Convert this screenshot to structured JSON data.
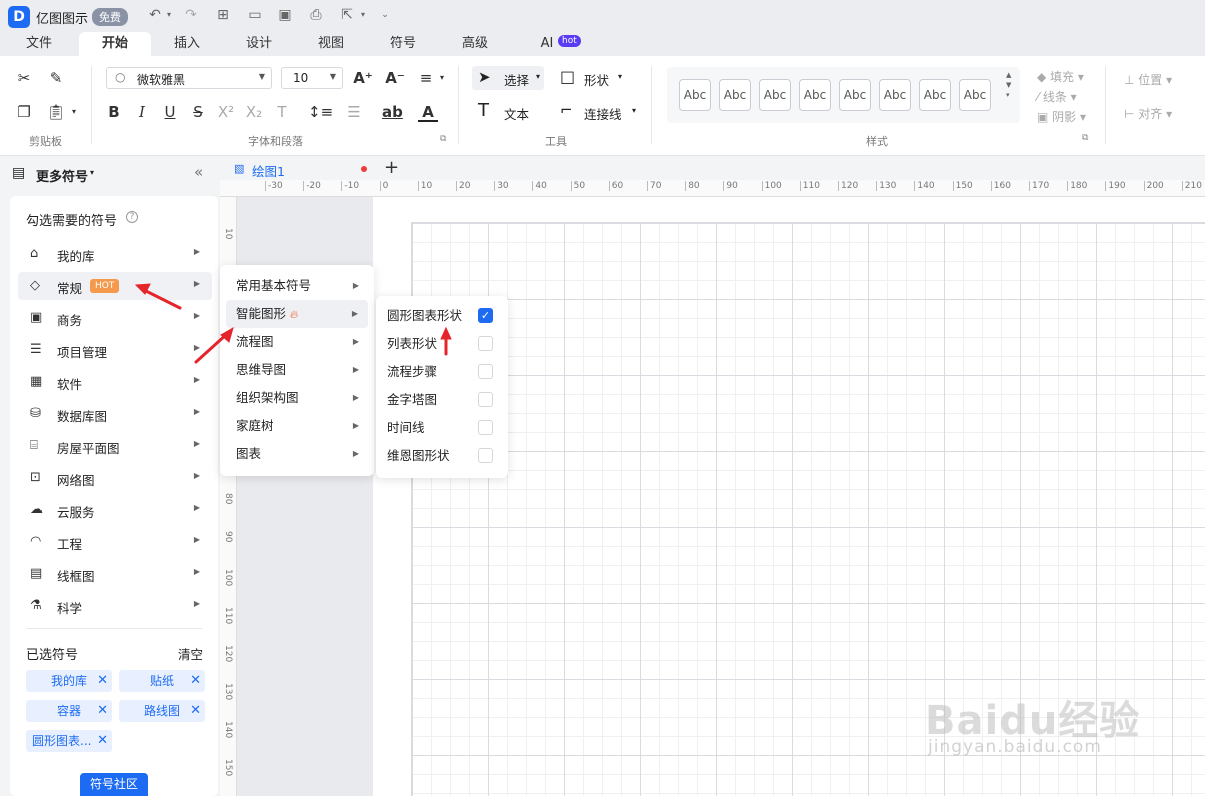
{
  "app": {
    "logo_glyph": "D",
    "name": "亿图图示",
    "free_badge": "免费"
  },
  "menu_tabs": [
    {
      "label": "文件"
    },
    {
      "label": "开始"
    },
    {
      "label": "插入"
    },
    {
      "label": "设计"
    },
    {
      "label": "视图"
    },
    {
      "label": "符号"
    },
    {
      "label": "高级"
    },
    {
      "label": "AI"
    }
  ],
  "ai_badge": "hot",
  "ribbon": {
    "font_name": "微软雅黑",
    "font_size": "10",
    "select_label": "选择",
    "shape_label": "形状",
    "text_label": "文本",
    "connector_label": "连接线",
    "style_sample": "Abc",
    "fill_label": "填充",
    "line_label": "线条",
    "shadow_label": "阴影",
    "position_label": "位置",
    "align_label": "对齐",
    "groups": {
      "clipboard": "剪贴板",
      "font_paragraph": "字体和段落",
      "tools": "工具",
      "styles": "样式"
    }
  },
  "left_panel": {
    "more_symbols": "更多符号",
    "section_title": "勾选需要的符号",
    "categories": [
      {
        "label": "我的库",
        "icon": "home-icon"
      },
      {
        "label": "常规",
        "icon": "tag-icon",
        "badge": "HOT"
      },
      {
        "label": "商务",
        "icon": "business-icon"
      },
      {
        "label": "项目管理",
        "icon": "project-icon"
      },
      {
        "label": "软件",
        "icon": "software-icon"
      },
      {
        "label": "数据库图",
        "icon": "database-icon"
      },
      {
        "label": "房屋平面图",
        "icon": "floorplan-icon"
      },
      {
        "label": "网络图",
        "icon": "network-icon"
      },
      {
        "label": "云服务",
        "icon": "cloud-icon"
      },
      {
        "label": "工程",
        "icon": "helmet-icon"
      },
      {
        "label": "线框图",
        "icon": "wireframe-icon"
      },
      {
        "label": "科学",
        "icon": "flask-icon"
      }
    ],
    "selected_title": "已选符号",
    "clear_label": "清空",
    "selected_chips": [
      "我的库",
      "贴纸",
      "容器",
      "路线图",
      "圆形图表..."
    ],
    "community_button": "符号社区"
  },
  "submenu_general": [
    "常用基本符号",
    "智能图形",
    "流程图",
    "思维导图",
    "组织架构图",
    "家庭树",
    "图表"
  ],
  "submenu_smart": [
    {
      "label": "圆形图表形状",
      "checked": true
    },
    {
      "label": "列表形状",
      "checked": false
    },
    {
      "label": "流程步骤",
      "checked": false
    },
    {
      "label": "金字塔图",
      "checked": false
    },
    {
      "label": "时间线",
      "checked": false
    },
    {
      "label": "维恩图形状",
      "checked": false
    }
  ],
  "document": {
    "tab_name": "绘图1",
    "add_tab": "+"
  },
  "ruler": {
    "top_ticks": [
      "-30",
      "-20",
      "-10",
      "0",
      "10",
      "20",
      "30",
      "40",
      "50",
      "60",
      "70",
      "80",
      "90",
      "100",
      "110",
      "120",
      "130",
      "140",
      "150",
      "160",
      "170",
      "180",
      "190",
      "200",
      "210"
    ],
    "left_ticks": [
      "10",
      "80",
      "90",
      "100",
      "110",
      "120",
      "130",
      "140",
      "150"
    ]
  },
  "watermark": {
    "brand": "Baidu经验",
    "url": "jingyan.baidu.com"
  }
}
